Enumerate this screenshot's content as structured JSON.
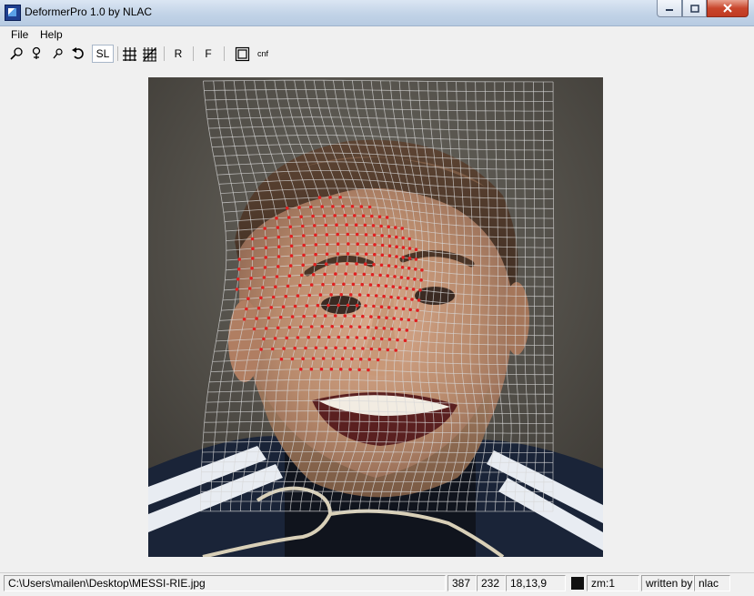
{
  "window": {
    "title": "DeformerPro 1.0 by NLAC"
  },
  "menu": {
    "file": "File",
    "help": "Help"
  },
  "toolbar": {
    "sl": "SL",
    "r": "R",
    "f": "F",
    "cnf": "cnf",
    "icons": [
      "zoom-in-icon",
      "zoom-pin-icon",
      "zoom-out-icon",
      "undo-icon",
      "grid-icon",
      "grid-dense-icon",
      "frame-icon"
    ]
  },
  "status": {
    "path": "C:\\Users\\mailen\\Desktop\\MESSI-RIE.jpg",
    "x": "387",
    "y": "232",
    "grid": "18,13,9",
    "color": "#111111",
    "zoom": "zm:1",
    "written_by": "written by",
    "author": "nlac"
  }
}
